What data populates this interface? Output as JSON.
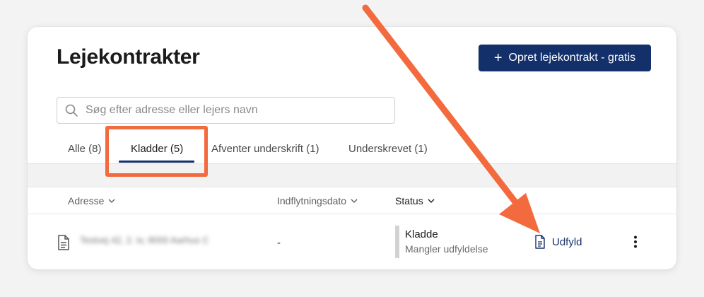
{
  "page": {
    "title": "Lejekontrakter"
  },
  "actions": {
    "create_label": "Opret lejekontrakt - gratis"
  },
  "search": {
    "placeholder": "Søg efter adresse eller lejers navn"
  },
  "tabs": [
    {
      "label": "Alle (8)",
      "active": false
    },
    {
      "label": "Kladder (5)",
      "active": true
    },
    {
      "label": "Afventer underskrift (1)",
      "active": false
    },
    {
      "label": "Underskrevet (1)",
      "active": false
    }
  ],
  "table": {
    "columns": [
      {
        "label": "Adresse"
      },
      {
        "label": "Indflytningsdato"
      },
      {
        "label": "Status"
      }
    ],
    "rows": [
      {
        "address": "Testvej 42, 2. tv, 8000 Aarhus C",
        "move_in_date": "-",
        "status": "Kladde",
        "status_detail": "Mangler udfyldelse",
        "action_label": "Udfyld"
      }
    ]
  },
  "colors": {
    "primary": "#13306b",
    "annotation": "#f26a3e"
  },
  "annotation": {
    "highlight_icon": "highlight-box",
    "arrow_icon": "orange-arrow"
  }
}
